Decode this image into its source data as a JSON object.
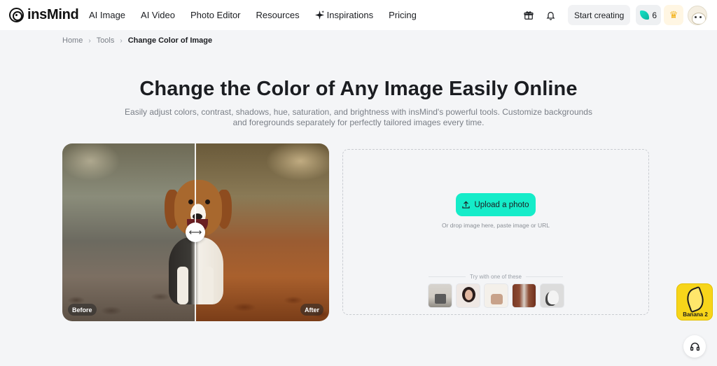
{
  "brand": {
    "name": "insMind"
  },
  "nav": {
    "items": [
      {
        "label": "AI Image"
      },
      {
        "label": "AI Video"
      },
      {
        "label": "Photo Editor"
      },
      {
        "label": "Resources"
      },
      {
        "label": "Inspirations",
        "icon": "sparkle-icon"
      },
      {
        "label": "Pricing"
      }
    ]
  },
  "header": {
    "start_label": "Start creating",
    "credits": "6",
    "icons": [
      "gift-icon",
      "bell-icon",
      "leaf-credits-icon",
      "crown-icon",
      "avatar"
    ]
  },
  "breadcrumb": {
    "home": "Home",
    "tools": "Tools",
    "current": "Change Color of Image"
  },
  "hero": {
    "title": "Change the Color of Any Image Easily Online",
    "subtitle": "Easily adjust colors, contrast, shadows, hue, saturation, and brightness with insMind's powerful tools. Customize backgrounds and foregrounds separately for perfectly tailored images every time."
  },
  "comparison": {
    "before_label": "Before",
    "after_label": "After",
    "handle_icon": "left-right-arrow-icon"
  },
  "upload": {
    "button_label": "Upload a photo",
    "hint": "Or drop image here, paste image or URL",
    "try_label": "Try with one of these",
    "samples": [
      "sample-products",
      "sample-woman",
      "sample-handbag",
      "sample-curtains",
      "sample-cat"
    ]
  },
  "floating": {
    "banana_label": "Banana 2",
    "support_icon": "headset-icon"
  },
  "colors": {
    "accent": "#15ecc9",
    "banana": "#f7d51a",
    "background": "#f4f5f7"
  }
}
